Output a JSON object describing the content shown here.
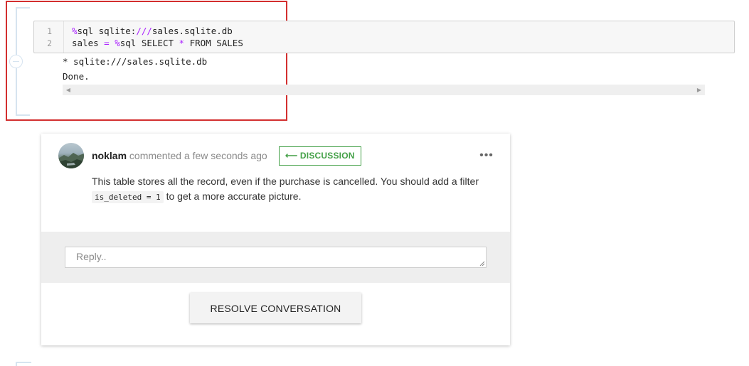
{
  "cell": {
    "line_numbers": [
      "1",
      "2"
    ],
    "line1": {
      "magic": "%",
      "cmd": "sql sqlite:",
      "op": "///",
      "rest": "sales.sqlite.db"
    },
    "line2": {
      "var": "sales ",
      "eq": "=",
      "sp": " ",
      "magic": "%",
      "cmd": "sql SELECT ",
      "star": "*",
      "rest": " FROM SALES"
    },
    "output": [
      "* sqlite:///sales.sqlite.db",
      "Done."
    ]
  },
  "comment": {
    "author": "noklam",
    "meta": " commented a few seconds ago",
    "tag": "⟵ DISCUSSION",
    "more": "•••",
    "body_part1": "This table stores all the record, even if the purchase is cancelled. You should add a filter ",
    "code": "is_deleted = 1",
    "body_part2": " to get a more accurate picture."
  },
  "reply": {
    "placeholder": "Reply.."
  },
  "actions": {
    "resolve_label": "RESOLVE CONVERSATION"
  },
  "colors": {
    "highlight": "#d32f2f",
    "discussion": "#43a047",
    "magic": "#aa22ff"
  }
}
